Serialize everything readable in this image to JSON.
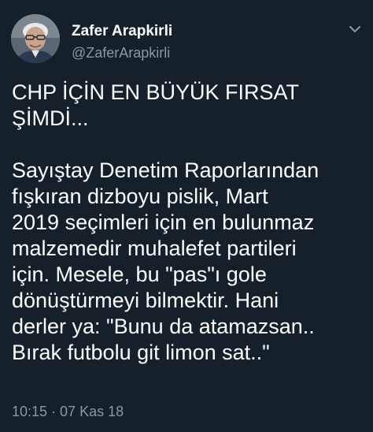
{
  "tweet": {
    "author": {
      "display_name": "Zafer Arapkirli",
      "handle": "@ZaferArapkirli"
    },
    "text": "CHP İÇİN EN BÜYÜK FIRSAT\nŞİMDİ...\n\nSayıştay Denetim Raporlarından\nfışkıran dizboyu pislik, Mart\n2019 seçimleri için en bulunmaz\nmalzemedir muhalefet partileri\niçin. Mesele, bu \"pas\"ı gole\ndönüştürmeyi bilmektir. Hani\nderler ya: \"Bunu da atamazsan..\nBırak futbolu git limon sat..\"",
    "timestamp": "10:15 · 07 Kas 18"
  },
  "icons": {
    "menu": "chevron-down-icon",
    "avatar": "profile-photo"
  },
  "colors": {
    "background": "#15202b",
    "primary_text": "#ffffff",
    "secondary_text": "#8899a6"
  }
}
